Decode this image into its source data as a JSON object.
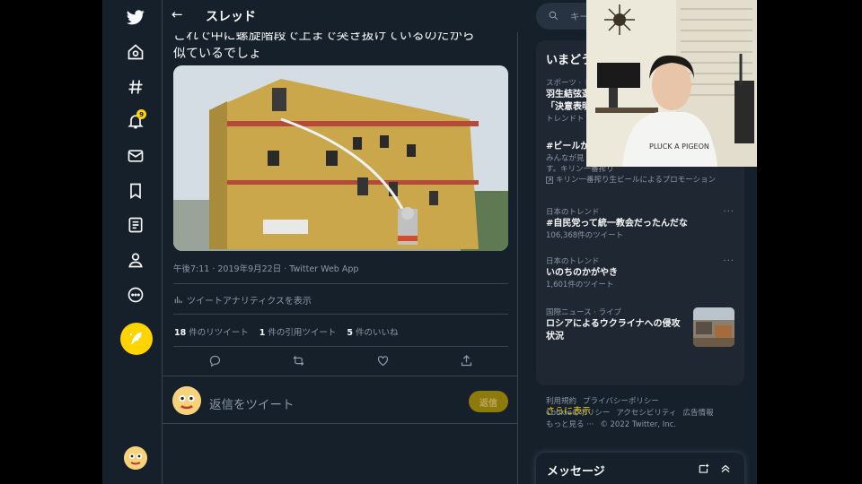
{
  "colors": {
    "bg": "#15202b",
    "accent": "#ffd400",
    "muted": "#8b98a5",
    "border": "#38444d"
  },
  "nav": {
    "items": [
      "twitter-logo",
      "home-icon",
      "hashtag-icon",
      "bell-icon",
      "mail-icon",
      "bookmark-icon",
      "list-icon",
      "profile-icon",
      "more-icon"
    ],
    "notification_badge": "9"
  },
  "header": {
    "back_icon": "←",
    "title": "スレッド"
  },
  "tweet": {
    "text_line1": "これで中に螺旋階段で上まで突き抜けているのだから",
    "text_line2": "似ているでしょ",
    "meta": "午後7:11 · 2019年9月22日 · Twitter Web App",
    "analytics": "ツイートアナリティクスを表示",
    "retweets_count": "18",
    "retweets_label": "件のリツイート",
    "quotes_count": "1",
    "quotes_label": "件の引用ツイート",
    "likes_count": "5",
    "likes_label": "件のいいね"
  },
  "reply": {
    "placeholder": "返信をツイート",
    "button": "返信"
  },
  "search": {
    "placeholder": "キー"
  },
  "trends": {
    "title": "いまどう",
    "items": [
      {
        "context": "スポーツ · ト",
        "name": "羽生結弦選",
        "name2": "「決意表明",
        "count": "トレンドト"
      },
      {
        "context": "",
        "name": "#ビールが",
        "extra1": "みんなが見",
        "extra2": "す。キリン一番搾り",
        "promo": "キリン一番搾り生ビールによるプロモーション"
      },
      {
        "context": "日本のトレンド",
        "name": "#自民党って統一教会だったんだな",
        "count": "106,368件のツイート"
      },
      {
        "context": "日本のトレンド",
        "name": "いのちのかがやき",
        "count": "1,601件のツイート"
      },
      {
        "context": "国際ニュース · ライブ",
        "name": "ロシアによるウクライナへの侵攻",
        "name2": "状況"
      }
    ],
    "show_more": "さらに表示"
  },
  "footer": {
    "links_line1": [
      "利用規約",
      "プライバシーポリシー"
    ],
    "links_line2": [
      "Cookieのポリシー",
      "アクセシビリティ",
      "広告情報"
    ],
    "more": "もっと見る ···",
    "copyright": "© 2022 Twitter, Inc."
  },
  "messages": {
    "title": "メッセージ"
  },
  "webcam": {
    "shirt_text": "PLUCK A PIGEON"
  }
}
